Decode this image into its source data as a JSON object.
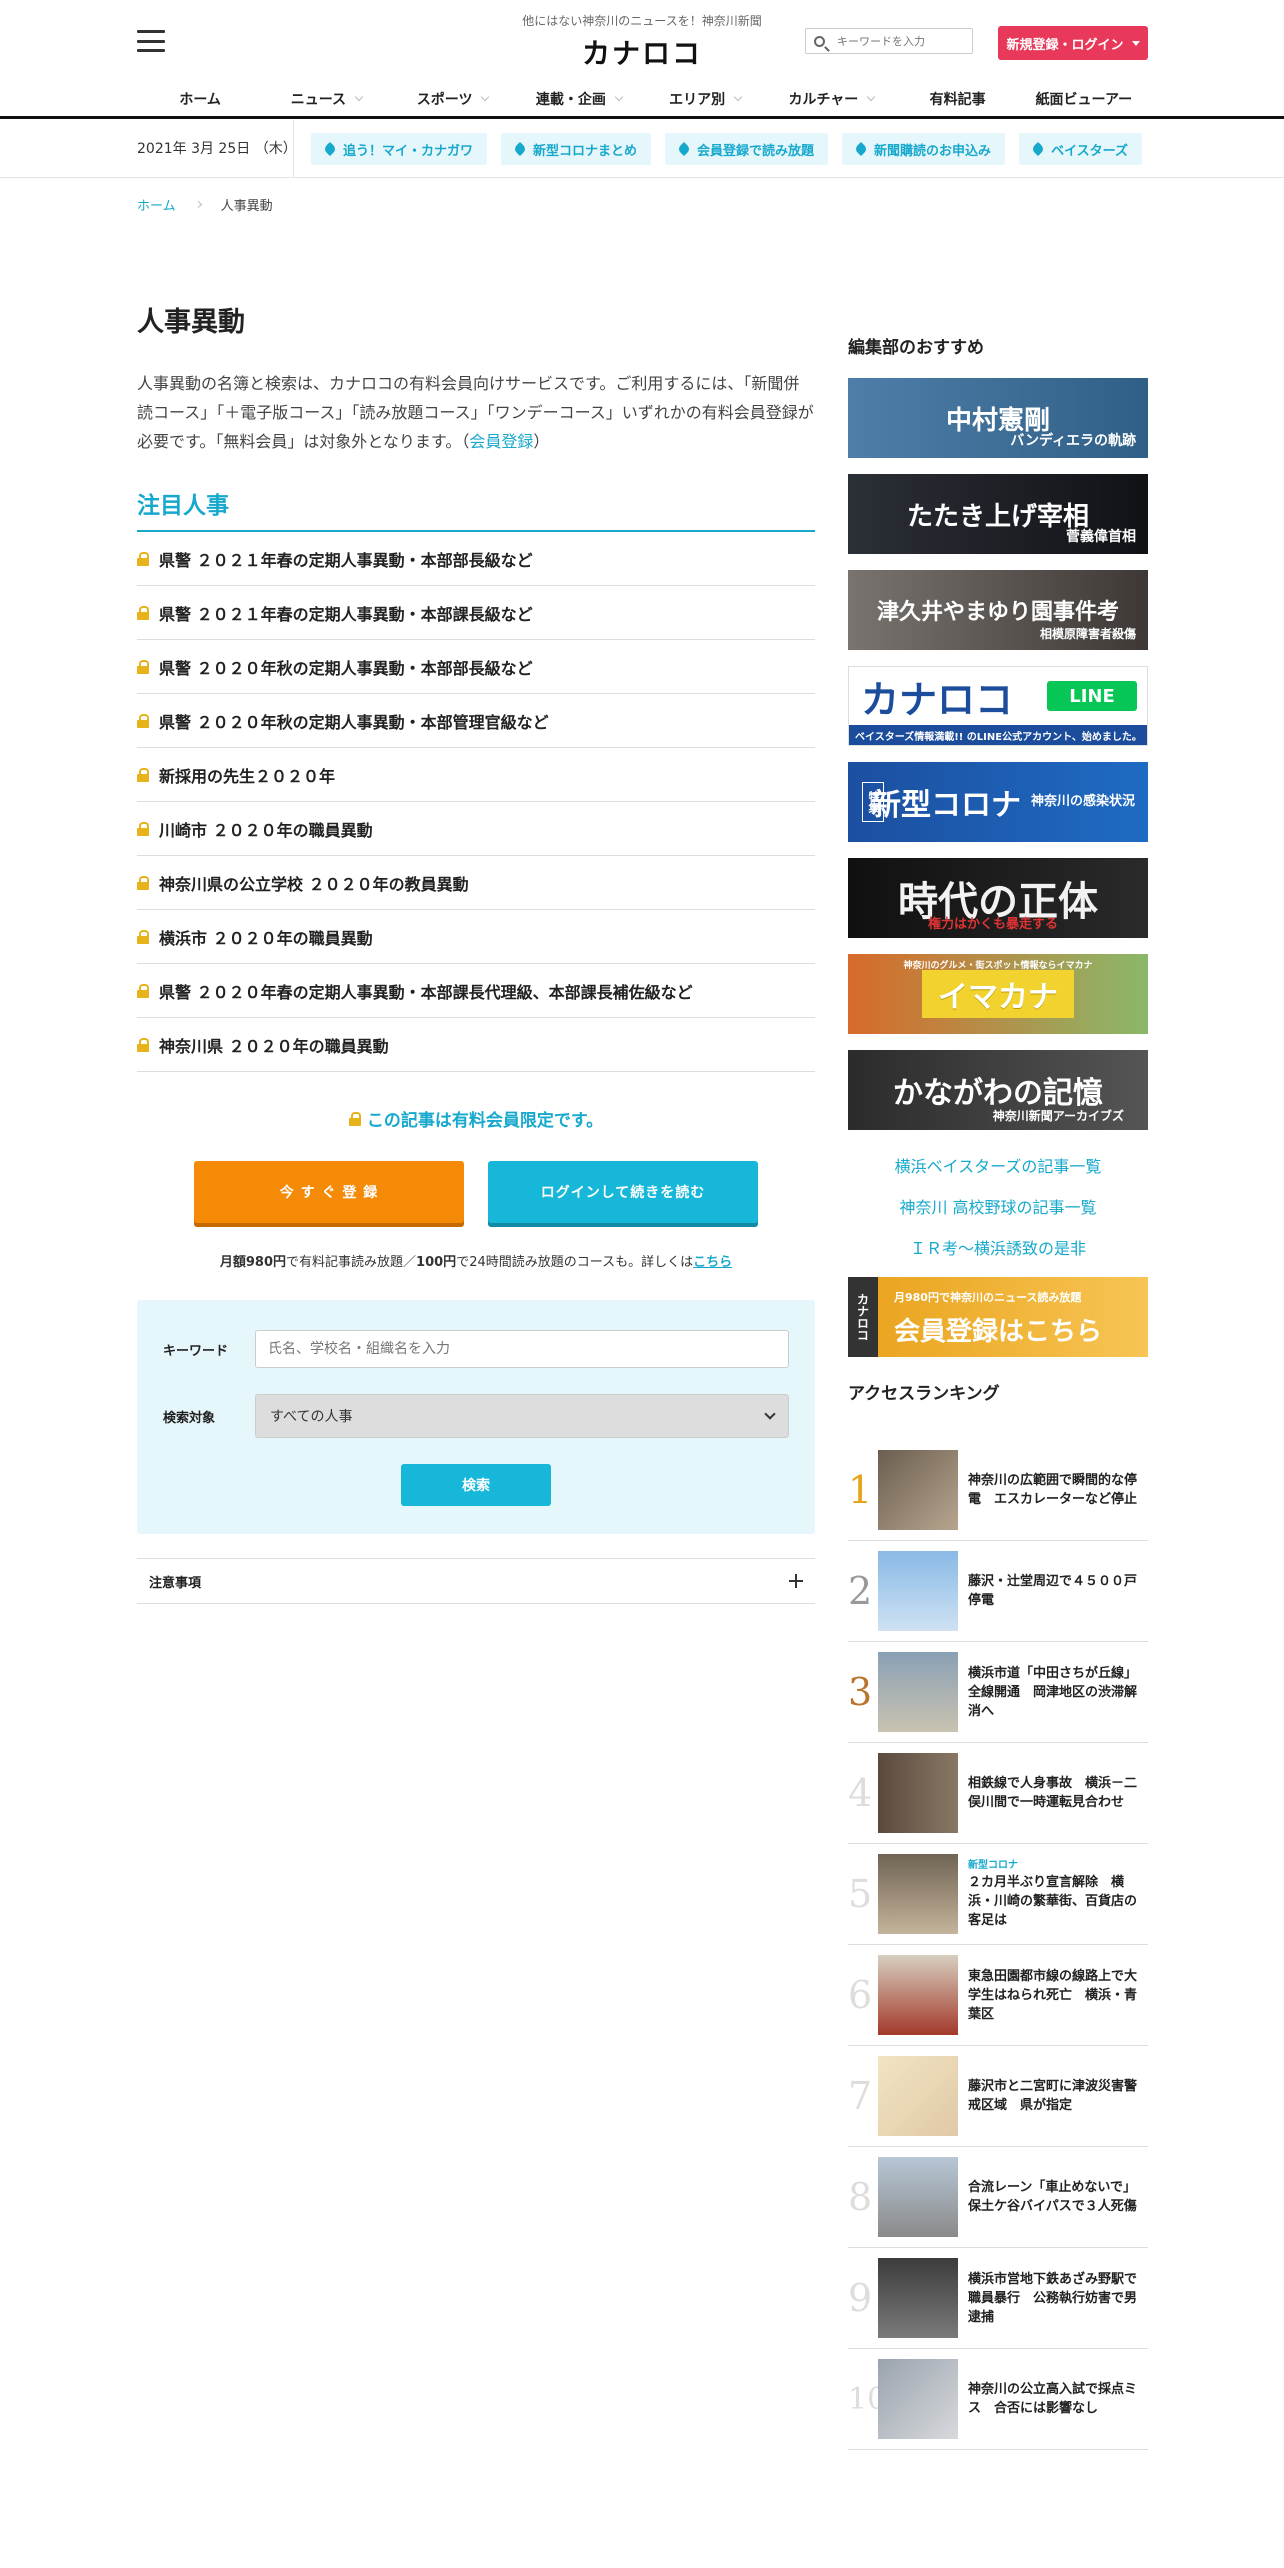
{
  "header": {
    "tagline": "他にはない神奈川のニュースを！神奈川新聞",
    "logo": "カナロコ",
    "search_placeholder": "キーワードを入力",
    "login_label": "新規登録・ログイン"
  },
  "nav": [
    {
      "label": "ホーム",
      "has_menu": false
    },
    {
      "label": "ニュース",
      "has_menu": true
    },
    {
      "label": "スポーツ",
      "has_menu": true
    },
    {
      "label": "連載・企画",
      "has_menu": true
    },
    {
      "label": "エリア別",
      "has_menu": true
    },
    {
      "label": "カルチャー",
      "has_menu": true
    },
    {
      "label": "有料記事",
      "has_menu": false
    },
    {
      "label": "紙面ビューアー",
      "has_menu": false
    }
  ],
  "tagbar": {
    "date": "2021年 3月 25日 （木）",
    "tags": [
      "追う！マイ・カナガワ",
      "新型コロナまとめ",
      "会員登録で読み放題",
      "新聞購読のお申込み",
      "ベイスターズ"
    ]
  },
  "breadcrumb": {
    "home": "ホーム",
    "current": "人事異動"
  },
  "main": {
    "title": "人事異動",
    "intro": "人事異動の名簿と検索は、カナロコの有料会員向けサービスです。ご利用するには、「新聞併読コース」「＋電子版コース」「読み放題コース」「ワンデーコース」いずれかの有料会員登録が必要です。「無料会員」は対象外となります。（",
    "intro_link": "会員登録",
    "intro_end": "）",
    "section_title": "注目人事",
    "items": [
      "県警 ２０２１年春の定期人事異動・本部部長級など",
      "県警 ２０２１年春の定期人事異動・本部課長級など",
      "県警 ２０２０年秋の定期人事異動・本部部長級など",
      "県警 ２０２０年秋の定期人事異動・本部管理官級など",
      "新採用の先生２０２０年",
      "川崎市 ２０２０年の職員異動",
      "神奈川県の公立学校 ２０２０年の教員異動",
      "横浜市 ２０２０年の職員異動",
      "県警 ２０２０年春の定期人事異動・本部課長代理級、本部課長補佐級など",
      "神奈川県 ２０２０年の職員異動"
    ],
    "members_only": "この記事は有料会員限定です。",
    "register_btn": "今 す ぐ 登 録",
    "login_btn": "ログインして続きを読む",
    "price_a": "月額",
    "price_b": "980円",
    "price_c": "で有料記事読み放題／",
    "price_d": "100円",
    "price_e": "で24時間読み放題のコースも。詳しくは",
    "price_link": "こちら",
    "search": {
      "keyword_label": "キーワード",
      "keyword_placeholder": "氏名、学校名・組織名を入力",
      "target_label": "検索対象",
      "target_value": "すべての人事",
      "submit": "検索"
    },
    "notes": "注意事項"
  },
  "sidebar": {
    "heading": "編集部のおすすめ",
    "banners": {
      "b1_main": "中村憲剛",
      "b1_sub": "バンディエラの軌跡",
      "b2_main": "たたき上げ宰相",
      "b2_sub": "菅義偉首相",
      "b3_main": "津久井やまゆり園事件考",
      "b3_sub": "相模原障害者殺傷",
      "b4_logo": "カナロコ",
      "b4_line": "LINE",
      "b4_bay": "ベイスターズ情報満載!! のLINE公式アカウント、始めました。",
      "b5_tag": "特集",
      "b5_main": "新型コロナ",
      "b5_sub": "神奈川の感染状況",
      "b6_main": "時代の正体",
      "b6_sub": "権力はかくも暴走する",
      "b7_top": "神奈川のグルメ・街スポット情報ならイマカナ",
      "b7_main": "イマカナ",
      "b8_main": "かながわの記憶",
      "b8_sub": "神奈川新聞アーカイブズ",
      "b9_tab": "カナロコ",
      "b9_top": "月980円で神奈川のニュース読み放題",
      "b9_main": "会員登録はこちら"
    },
    "links": [
      "横浜ベイスターズの記事一覧",
      "神奈川 高校野球の記事一覧",
      "ＩＲ考～横浜誘致の是非"
    ],
    "ranking_title": "アクセスランキング",
    "ranking": [
      {
        "num": "1",
        "cat": "",
        "text": "神奈川の広範囲で瞬間的な停電　エスカレーターなど停止"
      },
      {
        "num": "2",
        "cat": "",
        "text": "藤沢・辻堂周辺で４５００戸停電"
      },
      {
        "num": "3",
        "cat": "",
        "text": "横浜市道「中田さちが丘線」全線開通　岡津地区の渋滞解消へ"
      },
      {
        "num": "4",
        "cat": "",
        "text": "相鉄線で人身事故　横浜－二俣川間で一時運転見合わせ"
      },
      {
        "num": "5",
        "cat": "新型コロナ",
        "text": "２カ月半ぶり宣言解除　横浜・川崎の繁華街、百貨店の客足は"
      },
      {
        "num": "6",
        "cat": "",
        "text": "東急田園都市線の線路上で大学生はねられ死亡　横浜・青葉区"
      },
      {
        "num": "7",
        "cat": "",
        "text": "藤沢市と二宮町に津波災害警戒区域　県が指定"
      },
      {
        "num": "8",
        "cat": "",
        "text": "合流レーン「車止めないで」　保土ケ谷バイパスで３人死傷"
      },
      {
        "num": "9",
        "cat": "",
        "text": "横浜市営地下鉄あざみ野駅で職員暴行　公務執行妨害で男逮捕"
      },
      {
        "num": "10",
        "cat": "",
        "text": "神奈川の公立高入試で採点ミス　合否には影響なし"
      }
    ]
  }
}
